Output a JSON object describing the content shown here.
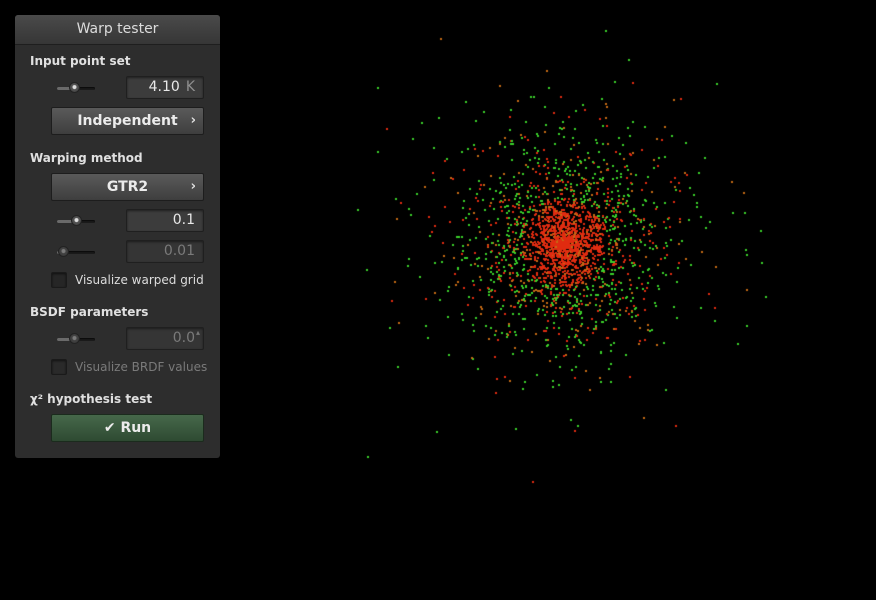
{
  "panel": {
    "title": "Warp tester",
    "input_section": "Input point set",
    "point_count": "4.10",
    "point_count_unit": "K",
    "point_count_slider": 0.45,
    "point_type": "Independent",
    "warp_section": "Warping method",
    "warp_method": "GTR2",
    "param1_value": "0.1",
    "param1_slider": 0.5,
    "param2_value": "0.01",
    "param2_slider": 0.05,
    "visualize_grid_label": "Visualize warped grid",
    "bsdf_section": "BSDF parameters",
    "bsdf_value": "0.0",
    "bsdf_slider": 0.45,
    "visualize_brdf_label": "Visualize BRDF values",
    "test_section": "χ² hypothesis test",
    "run_label": "Run"
  },
  "colors": {
    "point_red": "#e02b10",
    "point_green": "#3ad02a",
    "point_orange": "#c56a14",
    "run_button": "#3f6044"
  },
  "icons": {
    "chevron": "chevron-right-icon",
    "check": "check-icon"
  }
}
